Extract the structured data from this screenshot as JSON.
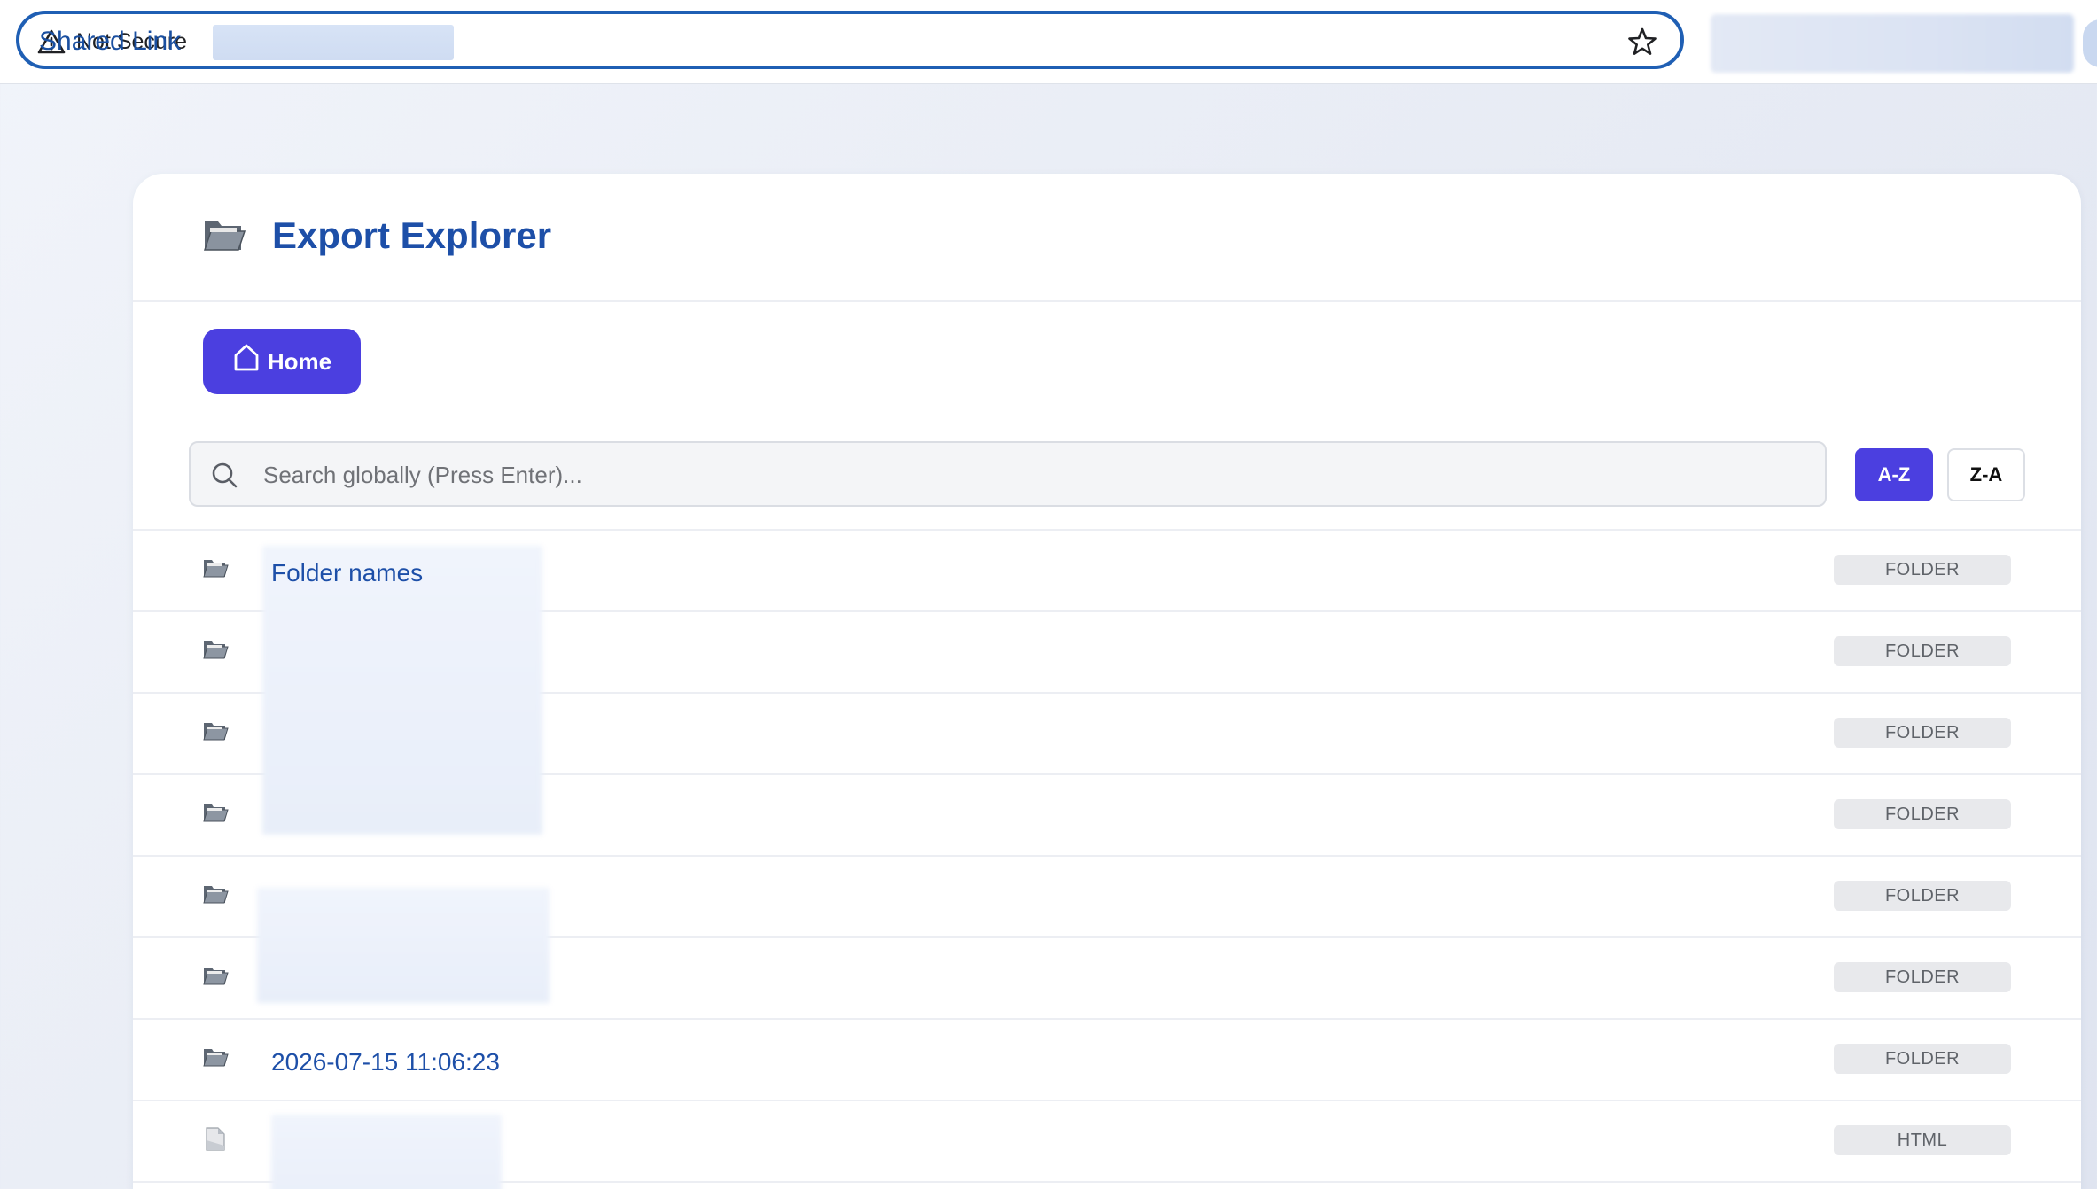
{
  "browser": {
    "security_label": "Not Secure",
    "url_text": "Shared Link"
  },
  "app": {
    "title": "Export Explorer",
    "home_label": "Home"
  },
  "search": {
    "placeholder": "Search globally (Press Enter)..."
  },
  "sort": {
    "az_label": "A-Z",
    "za_label": "Z-A",
    "active": "A-Z"
  },
  "entries": [
    {
      "name": "Folder names",
      "type": "FOLDER"
    },
    {
      "name": "",
      "type": "FOLDER"
    },
    {
      "name": "",
      "type": "FOLDER"
    },
    {
      "name": "",
      "type": "FOLDER"
    },
    {
      "name": "",
      "type": "FOLDER"
    },
    {
      "name": "",
      "type": "FOLDER"
    },
    {
      "name": "2026-07-15 11:06:23",
      "type": "FOLDER"
    },
    {
      "name": "",
      "type": "HTML"
    }
  ],
  "colors": {
    "accent": "#4b3fe0",
    "title": "#1d4fa8",
    "omnibox_border": "#1f5fb4"
  }
}
